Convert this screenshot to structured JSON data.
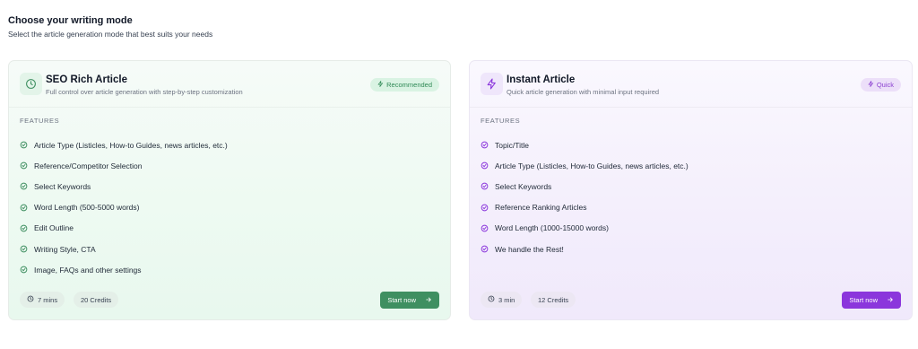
{
  "header": {
    "title": "Choose your writing mode",
    "subtitle": "Select the article generation mode that best suits your needs"
  },
  "colors": {
    "seo_accent": "#3f8f61",
    "instant_accent": "#8b36dc"
  },
  "modes": [
    {
      "title": "SEO Rich Article",
      "description": "Full control over article generation with step-by-step customization",
      "icon": "clock-icon",
      "badge": "Recommended",
      "features_label": "FEATURES",
      "features": [
        "Article Type (Listicles, How-to Guides, news articles, etc.)",
        "Reference/Competitor Selection",
        "Select Keywords",
        "Word Length (500-5000 words)",
        "Edit Outline",
        "Writing Style, CTA",
        "Image, FAQs and other settings"
      ],
      "time": "7 mins",
      "credits": "20 Credits",
      "button": "Start now"
    },
    {
      "title": "Instant Article",
      "description": "Quick article generation with minimal input required",
      "icon": "lightning-icon",
      "badge": "Quick",
      "features_label": "FEATURES",
      "features": [
        "Topic/Title",
        "Article Type (Listicles, How-to Guides, news articles, etc.)",
        "Select Keywords",
        "Reference Ranking Articles",
        "Word Length (1000-15000 words)",
        "We handle the Rest!"
      ],
      "time": "3 min",
      "credits": "12 Credits",
      "button": "Start now"
    }
  ]
}
